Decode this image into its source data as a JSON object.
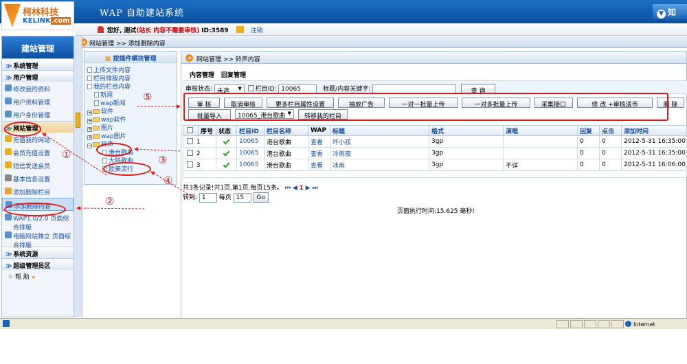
{
  "app": {
    "logo_cn": "柯林科技",
    "logo_en": "KELINK",
    "logo_suffix": ".com",
    "title": "WAP 自助建站系统",
    "top_right": "知"
  },
  "userbar": {
    "greeting": "您好,",
    "name": "测试",
    "role": "(站长",
    "status": "内容不需要审核)",
    "id_label": "ID:3589",
    "logout": "注销"
  },
  "breadcrumb": "网站管理 >> 添加删除内容",
  "sidebar": {
    "header": "建站管理",
    "sections": [
      {
        "label": "系统管理"
      },
      {
        "label": "用户管理",
        "items": [
          "修改我的资料",
          "用户资料管理",
          "用户身份管理"
        ]
      },
      {
        "label": "网站管理",
        "items": [
          "充值我的网站",
          "会员充值设置",
          "短信发送会员",
          "基本信息设置",
          "添加删除栏目",
          "添加删除内容",
          "WAP1.0/2.0 页面综合排版",
          "电脑网站独立 页面综合排版"
        ]
      },
      {
        "label": "系统资源"
      },
      {
        "label": "超级管理员区"
      }
    ],
    "help": "帮  助"
  },
  "tree": {
    "header": "按插件模块管理",
    "nodes": [
      "上传文件内容",
      "栏目排版内容",
      "我的栏目内容",
      "新闻",
      "wap新闻",
      "软件",
      "wap软件",
      "图片",
      "wap图片",
      "铃声",
      "港台歌曲",
      "大陆歌曲",
      "欧美流行"
    ]
  },
  "main": {
    "breadcrumb": "网站管理 >> 铃声内容",
    "tabs": [
      "内容管理",
      "回复管理"
    ],
    "filter": {
      "status_label": "审核状态:",
      "status_value": "未选",
      "column_label": "栏目ID:",
      "column_value": "10065",
      "keyword_label": "标题/内容关键字:",
      "keyword_value": "",
      "search": "查 询"
    },
    "actions": [
      "审 核",
      "取消审核",
      "更多栏目属性设置",
      "抽放广告",
      "一对一批量上传",
      "一对多批量上传",
      "采集接口",
      "修 改 +审核送币",
      "删 除",
      "批量导入",
      "10065_港台歌曲",
      "转移我的栏目"
    ],
    "columns": [
      "序号",
      "状态",
      "栏目ID",
      "栏目名称",
      "WAP",
      "标题",
      "格式",
      "演唱",
      "回复",
      "点击",
      "添加时间"
    ],
    "rows": [
      [
        "1",
        "",
        "10065",
        "港台歌曲",
        "查看",
        "坏小孩",
        "3gp",
        "",
        "0",
        "0",
        "2012-5-31 16:35:00"
      ],
      [
        "2",
        "",
        "10065",
        "港台歌曲",
        "查看",
        "冷雨夜",
        "3gp",
        "",
        "0",
        "0",
        "2012-5-31 16:35:00"
      ],
      [
        "3",
        "",
        "10065",
        "港台歌曲",
        "查看",
        "冰雨",
        "3gp",
        "不详",
        "0",
        "0",
        "2012-5-31 16:06:00"
      ]
    ],
    "pager": {
      "summary": "共3条记录!共1页,第1页,每页15条。",
      "current": "1",
      "goto_label": "转到:",
      "goto_value": "1",
      "per_page_label": "每页",
      "per_page_value": "15",
      "go": "Go"
    },
    "exec_time": "页面执行时间:15.625 毫秒!"
  },
  "statusbar": {
    "zone": "Internet"
  },
  "annotations": [
    "①",
    "②",
    "③",
    "④",
    "⑤"
  ]
}
